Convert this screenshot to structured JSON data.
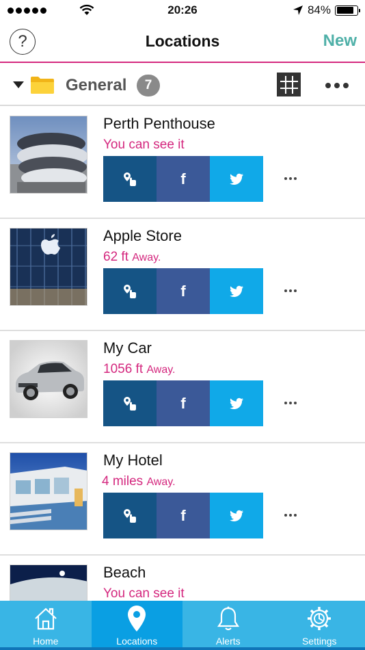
{
  "status_bar": {
    "time": "20:26",
    "battery": "84%",
    "battery_level": 0.84
  },
  "nav": {
    "help_label": "?",
    "title": "Locations",
    "new_label": "New"
  },
  "group": {
    "name": "General",
    "count": "7"
  },
  "actions": {
    "facebook_label": "f"
  },
  "locations": [
    {
      "title": "Perth Penthouse",
      "distance": "You can see it",
      "unit": ""
    },
    {
      "title": "Apple Store",
      "distance": "62 ft",
      "unit": "Away."
    },
    {
      "title": "My Car",
      "distance": "1056 ft",
      "unit": "Away."
    },
    {
      "title": "My Hotel",
      "distance": "4 miles",
      "unit": "Away."
    },
    {
      "title": "Beach",
      "distance": "You can see it",
      "unit": ""
    }
  ],
  "tabs": [
    {
      "label": "Home",
      "icon": "home-icon"
    },
    {
      "label": "Locations",
      "icon": "location-pin-icon"
    },
    {
      "label": "Alerts",
      "icon": "bell-icon"
    },
    {
      "label": "Settings",
      "icon": "gear-icon"
    }
  ],
  "colors": {
    "accent": "#d4277e",
    "new": "#4fb0a8",
    "tab_bar": "#39b5e5",
    "tab_active": "#0a9fe3",
    "facebook": "#3b5998",
    "twitter": "#10a9e8",
    "place": "#155485"
  }
}
